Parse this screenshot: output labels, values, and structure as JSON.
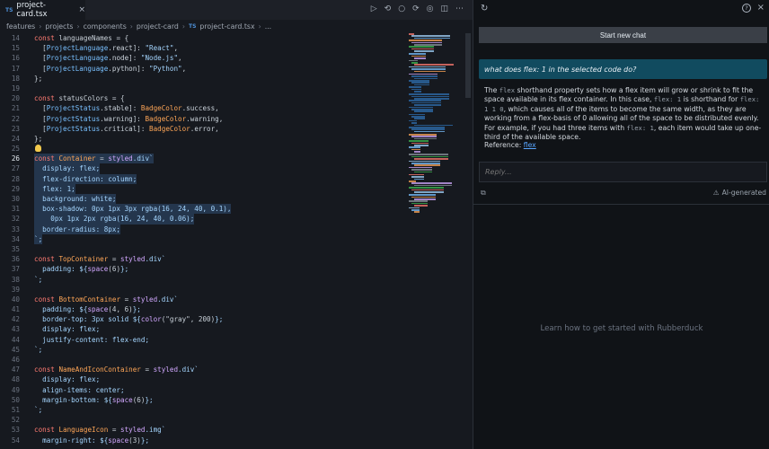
{
  "tab": {
    "lang": "TS",
    "name": "project-card.tsx",
    "close": "×"
  },
  "toolbar": {
    "icons": [
      "▷",
      "⟲",
      "○",
      "⟳",
      "◎",
      "◫",
      "⋯"
    ]
  },
  "breadcrumb": [
    "features",
    "projects",
    "components",
    "project-card",
    "project-card.tsx",
    "..."
  ],
  "breadcrumb_lang": "TS",
  "code": [
    {
      "n": "14",
      "t": [
        [
          "const ",
          "k"
        ],
        [
          "languageNames",
          ""
        ],
        [
          " = {",
          ""
        ]
      ]
    },
    {
      "n": "15",
      "t": [
        [
          "  [",
          ""
        ],
        [
          "ProjectLanguage",
          "n"
        ],
        [
          ".react]: ",
          ""
        ],
        [
          "\"React\"",
          "s"
        ],
        [
          ",",
          ""
        ]
      ]
    },
    {
      "n": "16",
      "t": [
        [
          "  [",
          ""
        ],
        [
          "ProjectLanguage",
          "n"
        ],
        [
          ".node]: ",
          ""
        ],
        [
          "\"Node.js\"",
          "s"
        ],
        [
          ",",
          ""
        ]
      ]
    },
    {
      "n": "17",
      "t": [
        [
          "  [",
          ""
        ],
        [
          "ProjectLanguage",
          "n"
        ],
        [
          ".python]: ",
          ""
        ],
        [
          "\"Python\"",
          "s"
        ],
        [
          ",",
          ""
        ]
      ]
    },
    {
      "n": "18",
      "t": [
        [
          "};",
          ""
        ]
      ]
    },
    {
      "n": "19",
      "t": []
    },
    {
      "n": "20",
      "t": [
        [
          "const ",
          "k"
        ],
        [
          "statusColors",
          ""
        ],
        [
          " = {",
          ""
        ]
      ]
    },
    {
      "n": "21",
      "t": [
        [
          "  [",
          ""
        ],
        [
          "ProjectStatus",
          "n"
        ],
        [
          ".stable]: ",
          ""
        ],
        [
          "BadgeColor",
          "v"
        ],
        [
          ".success,",
          ""
        ]
      ]
    },
    {
      "n": "22",
      "t": [
        [
          "  [",
          ""
        ],
        [
          "ProjectStatus",
          "n"
        ],
        [
          ".warning]: ",
          ""
        ],
        [
          "BadgeColor",
          "v"
        ],
        [
          ".warning,",
          ""
        ]
      ]
    },
    {
      "n": "23",
      "t": [
        [
          "  [",
          ""
        ],
        [
          "ProjectStatus",
          "n"
        ],
        [
          ".critical]: ",
          ""
        ],
        [
          "BadgeColor",
          "v"
        ],
        [
          ".error,",
          ""
        ]
      ]
    },
    {
      "n": "24",
      "t": [
        [
          "};",
          ""
        ]
      ]
    },
    {
      "n": "25",
      "t": [],
      "bulb": true
    },
    {
      "n": "26",
      "t": [
        [
          "const ",
          "k"
        ],
        [
          "Container",
          "v"
        ],
        [
          " = ",
          ""
        ],
        [
          "styled",
          "p"
        ],
        [
          ".div`",
          "s"
        ]
      ],
      "sel": true,
      "cur": true
    },
    {
      "n": "27",
      "t": [
        [
          "  display: flex;",
          "s"
        ]
      ],
      "sel": true
    },
    {
      "n": "28",
      "t": [
        [
          "  flex-direction: column;",
          "s"
        ]
      ],
      "sel": true
    },
    {
      "n": "29",
      "t": [
        [
          "  flex: 1;",
          "s"
        ]
      ],
      "sel": true
    },
    {
      "n": "30",
      "t": [
        [
          "  background: white;",
          "s"
        ]
      ],
      "sel": true
    },
    {
      "n": "31",
      "t": [
        [
          "  box-shadow: 0px 1px 3px rgba(16, 24, 40, 0.1),",
          "s"
        ]
      ],
      "sel": true
    },
    {
      "n": "32",
      "t": [
        [
          "    0px 1px 2px rgba(16, 24, 40, 0.06);",
          "s"
        ]
      ],
      "sel": true
    },
    {
      "n": "33",
      "t": [
        [
          "  border-radius: 8px;",
          "s"
        ]
      ],
      "sel": true
    },
    {
      "n": "34",
      "t": [
        [
          "`;",
          "s"
        ]
      ],
      "sel": true
    },
    {
      "n": "35",
      "t": []
    },
    {
      "n": "36",
      "t": [
        [
          "const ",
          "k"
        ],
        [
          "TopContainer",
          "v"
        ],
        [
          " = ",
          ""
        ],
        [
          "styled",
          "p"
        ],
        [
          ".div`",
          "s"
        ]
      ]
    },
    {
      "n": "37",
      "t": [
        [
          "  padding: ${",
          "s"
        ],
        [
          "space",
          "p"
        ],
        [
          "(6)",
          ""
        ],
        [
          "};",
          "s"
        ]
      ]
    },
    {
      "n": "38",
      "t": [
        [
          "`;",
          "s"
        ]
      ]
    },
    {
      "n": "39",
      "t": []
    },
    {
      "n": "40",
      "t": [
        [
          "const ",
          "k"
        ],
        [
          "BottomContainer",
          "v"
        ],
        [
          " = ",
          ""
        ],
        [
          "styled",
          "p"
        ],
        [
          ".div`",
          "s"
        ]
      ]
    },
    {
      "n": "41",
      "t": [
        [
          "  padding: ${",
          "s"
        ],
        [
          "space",
          "p"
        ],
        [
          "(4, 6)",
          ""
        ],
        [
          "};",
          "s"
        ]
      ]
    },
    {
      "n": "42",
      "t": [
        [
          "  border-top: 3px solid ${",
          "s"
        ],
        [
          "color",
          "p"
        ],
        [
          "(\"gray\", 200)",
          ""
        ],
        [
          "};",
          "s"
        ]
      ]
    },
    {
      "n": "43",
      "t": [
        [
          "  display: flex;",
          "s"
        ]
      ]
    },
    {
      "n": "44",
      "t": [
        [
          "  justify-content: flex-end;",
          "s"
        ]
      ]
    },
    {
      "n": "45",
      "t": [
        [
          "`;",
          "s"
        ]
      ]
    },
    {
      "n": "46",
      "t": []
    },
    {
      "n": "47",
      "t": [
        [
          "const ",
          "k"
        ],
        [
          "NameAndIconContainer",
          "v"
        ],
        [
          " = ",
          ""
        ],
        [
          "styled",
          "p"
        ],
        [
          ".div`",
          "s"
        ]
      ]
    },
    {
      "n": "48",
      "t": [
        [
          "  display: flex;",
          "s"
        ]
      ]
    },
    {
      "n": "49",
      "t": [
        [
          "  align-items: center;",
          "s"
        ]
      ]
    },
    {
      "n": "50",
      "t": [
        [
          "  margin-bottom: ${",
          "s"
        ],
        [
          "space",
          "p"
        ],
        [
          "(6)",
          ""
        ],
        [
          "};",
          "s"
        ]
      ]
    },
    {
      "n": "51",
      "t": [
        [
          "`;",
          "s"
        ]
      ]
    },
    {
      "n": "52",
      "t": []
    },
    {
      "n": "53",
      "t": [
        [
          "const ",
          "k"
        ],
        [
          "LanguageIcon",
          "v"
        ],
        [
          " = ",
          ""
        ],
        [
          "styled",
          "p"
        ],
        [
          ".img`",
          "s"
        ]
      ]
    },
    {
      "n": "54",
      "t": [
        [
          "  margin-right: ${",
          "s"
        ],
        [
          "space",
          "p"
        ],
        [
          "(3)",
          ""
        ],
        [
          "};",
          "s"
        ]
      ]
    }
  ],
  "panel": {
    "new_chat": "Start new chat",
    "question": "what does flex: 1 in the selected code do?",
    "answer": [
      [
        "The ",
        ""
      ],
      [
        "flex",
        "mono"
      ],
      [
        " shorthand property sets how a flex item will grow or shrink to fit the space available in its flex container. In this case, ",
        ""
      ],
      [
        "flex: 1",
        "mono"
      ],
      [
        " is shorthand for ",
        ""
      ],
      [
        "flex: 1 1 0",
        "mono"
      ],
      [
        ", which causes all of the items to become the same width, as they are working from a flex-basis of 0 allowing all of the space to be distributed evenly. For example, if you had three items with ",
        ""
      ],
      [
        "flex: 1",
        "mono"
      ],
      [
        ", each item would take up one-third of the available space.",
        ""
      ]
    ],
    "reference_label": "Reference: ",
    "reference_link": "flex",
    "reply_placeholder": "Reply...",
    "ai_generated": "AI-generated",
    "learn": "Learn how to get started with Rubberduck",
    "help_icon": "?",
    "close_icon": "×"
  },
  "colors": {
    "accent": "#114b5f",
    "selection": "#24364d",
    "link": "#58a6ff"
  }
}
